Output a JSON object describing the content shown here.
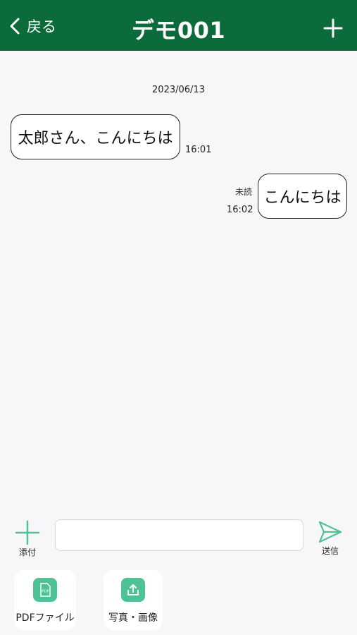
{
  "header": {
    "back_label": "戻る",
    "title": "デモ001"
  },
  "chat": {
    "date": "2023/06/13",
    "messages": [
      {
        "side": "left",
        "text": "太郎さん、こんにちは",
        "time": "16:01"
      },
      {
        "side": "right",
        "text": "こんにちは",
        "time": "16:02",
        "status": "未読"
      }
    ]
  },
  "composer": {
    "attach_label": "添付",
    "input_value": "",
    "input_placeholder": "",
    "send_label": "送信"
  },
  "attach_options": [
    {
      "label": "PDFファイル",
      "icon": "pdf-file-icon"
    },
    {
      "label": "写真・画像",
      "icon": "image-upload-icon"
    }
  ],
  "colors": {
    "header_bg": "#0b6b3a",
    "accent": "#4cc295",
    "background": "#f7f7f9"
  }
}
